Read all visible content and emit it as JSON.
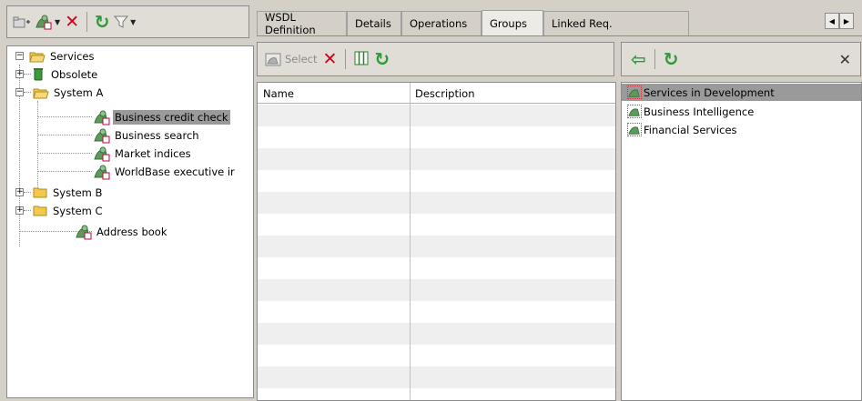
{
  "left_toolbar": {
    "icons": [
      "new-folder-icon",
      "new-service-icon",
      "delete-icon",
      "refresh-icon",
      "filter-icon"
    ]
  },
  "tree": {
    "root": "Services",
    "items": [
      {
        "label": "Obsolete",
        "icon": "obsolete-bin-icon"
      },
      {
        "label": "System A",
        "icon": "folder-open-icon"
      },
      {
        "label": "Business credit check",
        "icon": "service-icon",
        "selected": true
      },
      {
        "label": "Business search",
        "icon": "service-icon"
      },
      {
        "label": "Market indices",
        "icon": "service-icon"
      },
      {
        "label": "WorldBase executive ir",
        "icon": "service-icon"
      },
      {
        "label": "System B",
        "icon": "folder-icon"
      },
      {
        "label": "System C",
        "icon": "folder-icon"
      },
      {
        "label": "Address book",
        "icon": "service-icon"
      }
    ]
  },
  "tabs": [
    {
      "label": "WSDL Definition"
    },
    {
      "label": "Details"
    },
    {
      "label": "Operations"
    },
    {
      "label": "Groups",
      "active": true
    },
    {
      "label": "Linked Req."
    }
  ],
  "middle": {
    "select_label": "Select",
    "columns": [
      "Name",
      "Description"
    ],
    "rows": []
  },
  "right": {
    "groups": [
      {
        "label": "Services in Development",
        "selected": true
      },
      {
        "label": "Business Intelligence"
      },
      {
        "label": "Financial Services"
      }
    ]
  },
  "colors": {
    "selection": "#9a9a9a",
    "delete_red": "#d4001a",
    "refresh_green": "#2f9a3a",
    "folder_yellow": "#f2c94c"
  }
}
